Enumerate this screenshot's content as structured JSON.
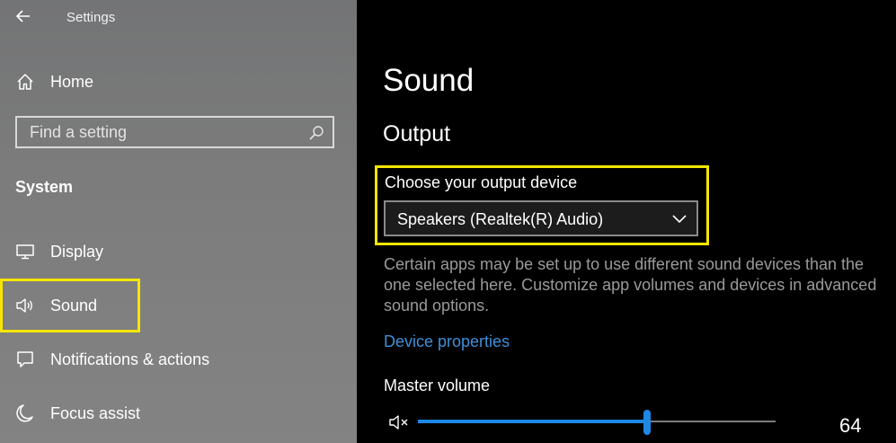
{
  "app": {
    "title": "Settings"
  },
  "sidebar": {
    "home_label": "Home",
    "search": {
      "placeholder": "Find a setting"
    },
    "section_title": "System",
    "items": [
      {
        "label": "Display",
        "icon": "monitor-icon"
      },
      {
        "label": "Sound",
        "icon": "speaker-icon",
        "selected": true
      },
      {
        "label": "Notifications & actions",
        "icon": "notification-icon"
      },
      {
        "label": "Focus assist",
        "icon": "moon-icon"
      }
    ]
  },
  "main": {
    "page_title": "Sound",
    "output": {
      "title": "Output",
      "device_label": "Choose your output device",
      "device_value": "Speakers (Realtek(R) Audio)",
      "description": "Certain apps may be set up to use different sound devices than the one selected here. Customize app volumes and devices in advanced sound options.",
      "device_properties_link": "Device properties",
      "volume_label": "Master volume",
      "volume_value": "64",
      "volume_fraction": 0.64
    }
  },
  "colors": {
    "highlight": "#f5e600",
    "accent": "#1e88e5",
    "link": "#3f8fd8",
    "sidebar_bg": "#7a7a7a",
    "main_bg": "#000000"
  }
}
